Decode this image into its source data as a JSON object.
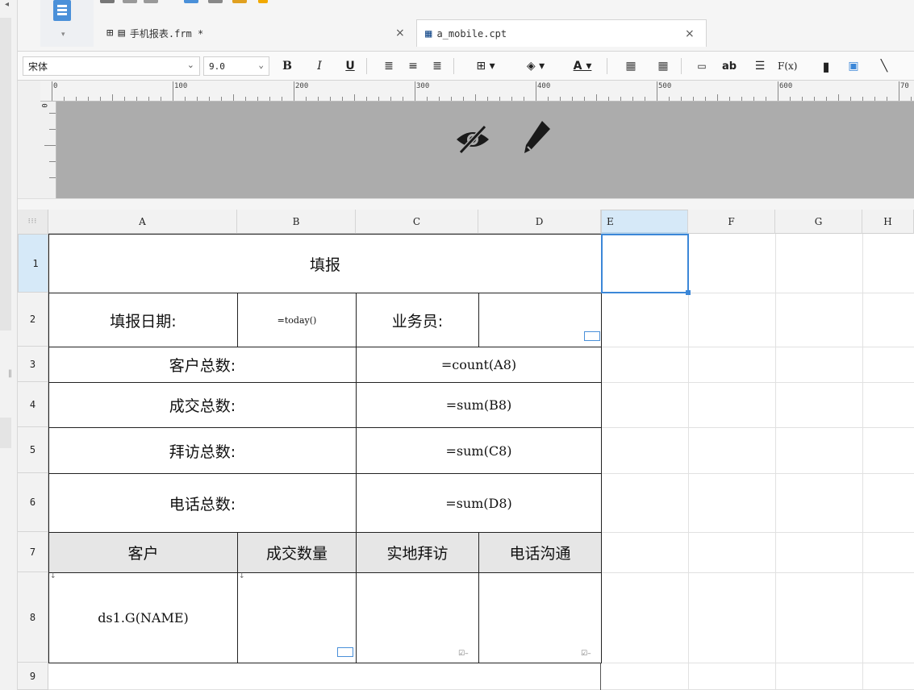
{
  "tabs": [
    {
      "label": "手机报表.frm *",
      "close": "×",
      "active": false
    },
    {
      "label": "a_mobile.cpt",
      "close": "×",
      "active": true
    }
  ],
  "toolbar": {
    "font_name": "宋体",
    "font_size": "9.0",
    "bold": "B",
    "italic": "I",
    "underline": "U",
    "text_button": "ab",
    "formula_button": "F(x)"
  },
  "ruler": {
    "marks": [
      "0",
      "100",
      "200",
      "300",
      "400",
      "500",
      "600",
      "70"
    ]
  },
  "vruler": {
    "mark": "0"
  },
  "grid": {
    "columns": [
      "A",
      "B",
      "C",
      "D",
      "E",
      "F",
      "G",
      "H"
    ],
    "rows": [
      "1",
      "2",
      "3",
      "4",
      "5",
      "6",
      "7",
      "8",
      "9"
    ],
    "selected_column": "E",
    "selected_row": "1"
  },
  "report": {
    "title": "填报",
    "date_label": "填报日期:",
    "date_formula": "=today()",
    "salesman_label": "业务员:",
    "customer_total_label": "客户总数:",
    "customer_total_formula": "=count(A8)",
    "deal_total_label": "成交总数:",
    "deal_total_formula": "=sum(B8)",
    "visit_total_label": "拜访总数:",
    "visit_total_formula": "=sum(C8)",
    "phone_total_label": "电话总数:",
    "phone_total_formula": "=sum(D8)",
    "headers": [
      "客户",
      "成交数量",
      "实地拜访",
      "电话沟通"
    ],
    "detail_cell": "ds1.G(NAME)"
  }
}
